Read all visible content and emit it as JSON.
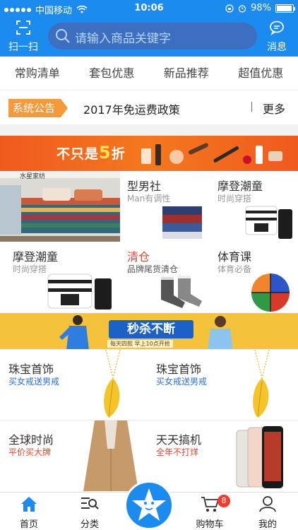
{
  "status": {
    "carrier": "中国移动",
    "time": "10:06",
    "battery": "98%"
  },
  "header": {
    "scan_label": "扫一扫",
    "search_placeholder": "请输入商品关键字",
    "message_label": "消息"
  },
  "categories": [
    "常购清单",
    "套包优惠",
    "新品推荐",
    "超值优惠"
  ],
  "notice": {
    "tag": "系统公告",
    "text": "2017年免运费政策",
    "more": "更多"
  },
  "banner1": {
    "title_prefix": "不只是",
    "title_num": "5",
    "title_suffix": "折"
  },
  "bedroom": {
    "brand": "水星家纺"
  },
  "products_row1": [
    {
      "name": "型男社",
      "desc": "Man有调性"
    },
    {
      "name": "摩登潮童",
      "desc": "时尚穿搭"
    }
  ],
  "products_row2": [
    {
      "name": "摩登潮童",
      "desc": "时尚穿搭"
    },
    {
      "name": "清仓",
      "desc": "品牌尾货清仓"
    },
    {
      "name": "体育课",
      "desc": "体育必备"
    }
  ],
  "banner2": {
    "title": "秒杀不断",
    "subtitle": "每天四款 早上10点开抢"
  },
  "products_row3": [
    {
      "name": "珠宝首饰",
      "desc": "买女戒送男戒"
    },
    {
      "name": "珠宝首饰",
      "desc": "买女戒送男戒"
    }
  ],
  "products_row4": [
    {
      "name": "全球时尚",
      "desc": "平价买大牌"
    },
    {
      "name": "天天搞机",
      "desc": "全年不打烊"
    }
  ],
  "tabbar": {
    "home": "首页",
    "category": "分类",
    "cart": "购物车",
    "cart_count": "8",
    "mine": "我的"
  },
  "colors": {
    "brand_blue": "#1b8bf0",
    "accent_red": "#e0452b",
    "notice_orange": "#f59a3a",
    "seckill_yellow": "#f4c33a"
  }
}
